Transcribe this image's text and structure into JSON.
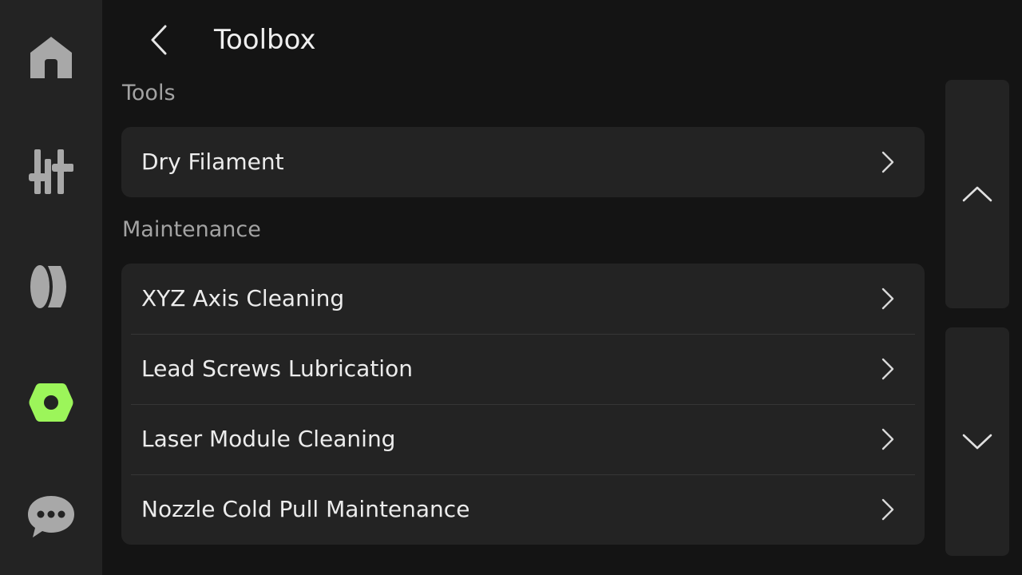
{
  "header": {
    "title": "Toolbox"
  },
  "nav": {
    "items": [
      {
        "icon": "home-icon",
        "active": false
      },
      {
        "icon": "sliders-icon",
        "active": false
      },
      {
        "icon": "filament-icon",
        "active": false
      },
      {
        "icon": "hex-nut-icon",
        "active": true
      },
      {
        "icon": "chat-bubble-icon",
        "active": false
      }
    ],
    "active_color": "#9cf55a",
    "inactive_color": "#a8a8a8"
  },
  "sections": {
    "tools": {
      "label": "Tools",
      "items": [
        "Dry Filament"
      ]
    },
    "maintenance": {
      "label": "Maintenance",
      "items": [
        "XYZ Axis Cleaning",
        "Lead Screws Lubrication",
        "Laser Module Cleaning",
        "Nozzle Cold Pull Maintenance"
      ]
    }
  },
  "scroll": {
    "up_icon": "chevron-up-icon",
    "down_icon": "chevron-down-icon"
  }
}
